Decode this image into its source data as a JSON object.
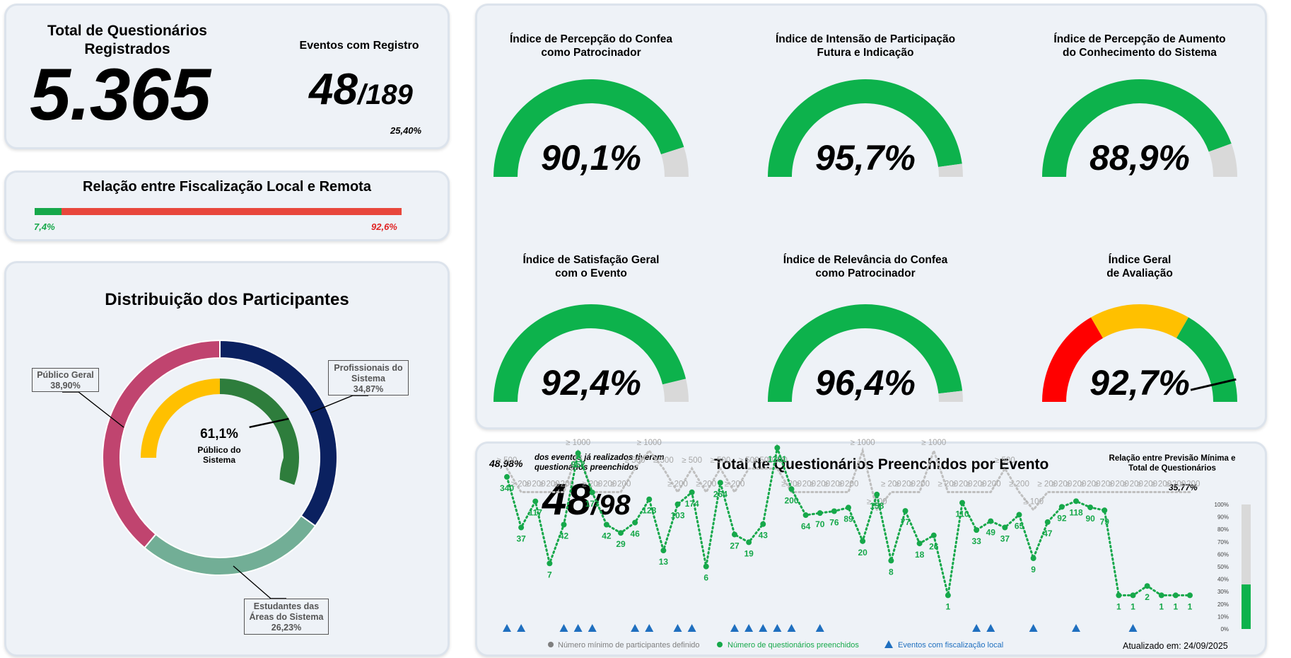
{
  "kpi": {
    "total_label_line1": "Total de Questionários",
    "total_label_line2": "Registrados",
    "total_value": "5.365",
    "events_label": "Eventos com Registro",
    "events_value": "48",
    "events_total": "/189",
    "events_pct": "25,40%"
  },
  "local_remote": {
    "title": "Relação entre Fiscalização Local e Remota",
    "local_pct": "7,4%",
    "remote_pct": "92,6%",
    "local_value": 7.4,
    "remote_value": 92.6,
    "colors": {
      "local": "#16a84a",
      "remote": "#e8473c"
    }
  },
  "distribution": {
    "title": "Distribuição dos Participantes",
    "center_value": "61,1%",
    "center_label_line1": "Público do",
    "center_label_line2": "Sistema",
    "callouts": {
      "publico_line1": "Público Geral",
      "publico_line2": "38,90%",
      "prof_line1": "Profissionais do",
      "prof_line2": "Sistema",
      "prof_line3": "34,87%",
      "est_line1": "Estudantes das",
      "est_line2": "Áreas do Sistema",
      "est_line3": "26,23%"
    }
  },
  "gauges": [
    {
      "title1": "Índice de Percepção do Confea",
      "title2": "como Patrocinador",
      "value": "90,1%"
    },
    {
      "title1": "Índice de Intensão de Participação",
      "title2": "Futura e Indicação",
      "value": "95,7%"
    },
    {
      "title1": "Índice de Percepção de Aumento",
      "title2": "do Conhecimento do Sistema",
      "value": "88,9%"
    },
    {
      "title1": "Índice de Satisfação Geral",
      "title2": "com o Evento",
      "value": "92,4%"
    },
    {
      "title1": "Índice de Relevância do Confea",
      "title2": "como Patrocinador",
      "value": "96,4%"
    },
    {
      "title1": "Índice Geral",
      "title2": "de Avaliação",
      "value": "92,7%"
    }
  ],
  "events_chart": {
    "title": "Total de Questionários Preenchidos por Evento",
    "done_pct": "48,98%",
    "done_text_line1": "dos eventos já realizados tiveram",
    "done_text_line2": "questionários preenchidos",
    "done_value": "48",
    "done_total": "/98",
    "ratio_title_line1": "Relação entre Previsão Mínima e",
    "ratio_title_line2": "Total de Questionários",
    "ratio_pct": "35,77%",
    "legend_min": "Número mínimo de participantes definido",
    "legend_count": "Número de questionários preenchidos",
    "legend_local": "Eventos com fiscalização local",
    "updated": "Atualizado em: 24/09/2025",
    "colors": {
      "count": "#16a84a",
      "min": "#bfbfbf",
      "local": "#1f6fbf",
      "label_min": "#a6a6a6"
    }
  },
  "chart_data": [
    {
      "type": "bar",
      "title": "Relação entre Fiscalização Local e Remota",
      "categories": [
        "Local",
        "Remota"
      ],
      "values": [
        7.4,
        92.6
      ]
    },
    {
      "type": "pie",
      "title": "Distribuição dos Participantes",
      "outer": [
        {
          "label": "Profissionais do Sistema",
          "value": 34.87,
          "color": "#0b2160"
        },
        {
          "label": "Estudantes das Áreas do Sistema",
          "value": 26.23,
          "color": "#72ae96"
        },
        {
          "label": "Público Geral",
          "value": 38.9,
          "color": "#c0446f"
        }
      ],
      "inner": {
        "label": "Público do Sistema",
        "value": 61.1,
        "colors": [
          "#2e7d3c",
          "#ffc000"
        ]
      }
    },
    {
      "type": "gauge",
      "series": [
        {
          "name": "Índice de Percepção do Confea como Patrocinador",
          "values": [
            90.1
          ]
        },
        {
          "name": "Índice de Intensão de Participação Futura e Indicação",
          "values": [
            95.7
          ]
        },
        {
          "name": "Índice de Percepção de Aumento do Conhecimento do Sistema",
          "values": [
            88.9
          ]
        },
        {
          "name": "Índice de Satisfação Geral com o Evento",
          "values": [
            92.4
          ]
        },
        {
          "name": "Índice de Relevância do Confea como Patrocinador",
          "values": [
            96.4
          ]
        },
        {
          "name": "Índice Geral de Avaliação",
          "values": [
            92.7
          ]
        }
      ],
      "ylim": [
        0,
        100
      ]
    },
    {
      "type": "line",
      "title": "Total de Questionários Preenchidos por Evento",
      "x": [
        1,
        2,
        3,
        4,
        5,
        6,
        7,
        8,
        9,
        10,
        11,
        12,
        13,
        14,
        15,
        16,
        17,
        18,
        19,
        20,
        21,
        22,
        23,
        24,
        25,
        26,
        27,
        28,
        29,
        30,
        31,
        32,
        33,
        34,
        35,
        36,
        37,
        38,
        39,
        40,
        41,
        42,
        43,
        44,
        45,
        46,
        47,
        48,
        49
      ],
      "counts": [
        340,
        37,
        117,
        7,
        42,
        952,
        173,
        42,
        29,
        46,
        128,
        13,
        103,
        174,
        6,
        264,
        27,
        19,
        43,
        1201,
        200,
        64,
        70,
        76,
        89,
        20,
        158,
        8,
        77,
        18,
        26,
        1,
        110,
        33,
        49,
        37,
        65,
        9,
        47,
        92,
        118,
        90,
        79,
        1,
        1,
        2,
        1,
        1,
        1
      ],
      "count_labels": [
        "340",
        "37",
        "117",
        "7",
        "42",
        "952",
        "173",
        "42",
        "29",
        "46",
        "128",
        "13",
        "103",
        "174",
        "6",
        "264",
        "27",
        "19",
        "43",
        "1201",
        "200",
        "64",
        "70",
        "76",
        "89",
        "20",
        "158",
        "8",
        "77",
        "18",
        "26",
        "1",
        "110",
        "33",
        "49",
        "37",
        "65",
        "9",
        "47",
        "92",
        "118",
        "90",
        "79",
        "1",
        "1",
        "2",
        "1",
        "1",
        "1"
      ],
      "min_labels": [
        "≥ 500",
        "≥ 200",
        "≥ 200",
        "≥ 200",
        "≥ 200",
        "≥ 1000",
        "≥ 200",
        "≥ 200",
        "≥ 200",
        "≥ 500",
        "≥ 1000",
        "≥ 500",
        "≥ 200",
        "≥ 500",
        "≥ 200",
        "≥ 500",
        "≥ 200",
        "≥ 500",
        "≥ 500",
        "≥ 500",
        "≥ 200",
        "≥ 200",
        "≥ 200",
        "≥ 200",
        "≥ 200",
        "≥ 1000",
        "≥ 100",
        "≥ 200",
        "≥ 200",
        "≥ 200",
        "≥ 1000",
        "≥ 200",
        "≥ 200",
        "≥ 200",
        "≥ 200",
        "≥ 500",
        "≥ 200",
        "≥ 100",
        "≥ 200",
        "≥ 200",
        "≥ 200",
        "≥ 200",
        "≥ 200",
        "≥ 200",
        "≥ 200",
        "≥ 200",
        "≥ 200",
        "≥ 200",
        "≥ 200"
      ],
      "min_values": [
        500,
        200,
        200,
        200,
        200,
        1000,
        200,
        200,
        200,
        500,
        1000,
        500,
        200,
        500,
        200,
        500,
        200,
        500,
        500,
        500,
        200,
        200,
        200,
        200,
        200,
        1000,
        100,
        200,
        200,
        200,
        1000,
        200,
        200,
        200,
        200,
        500,
        200,
        100,
        200,
        200,
        200,
        200,
        200,
        200,
        200,
        200,
        200,
        200,
        200
      ],
      "local_events": [
        1,
        2,
        5,
        6,
        7,
        10,
        11,
        13,
        14,
        17,
        18,
        19,
        20,
        21,
        23,
        34,
        35,
        38,
        41,
        45
      ],
      "side_bar": {
        "value": 35.77,
        "ticks": [
          "0%",
          "10%",
          "20%",
          "30%",
          "40%",
          "50%",
          "60%",
          "70%",
          "80%",
          "90%",
          "100%"
        ]
      }
    }
  ]
}
